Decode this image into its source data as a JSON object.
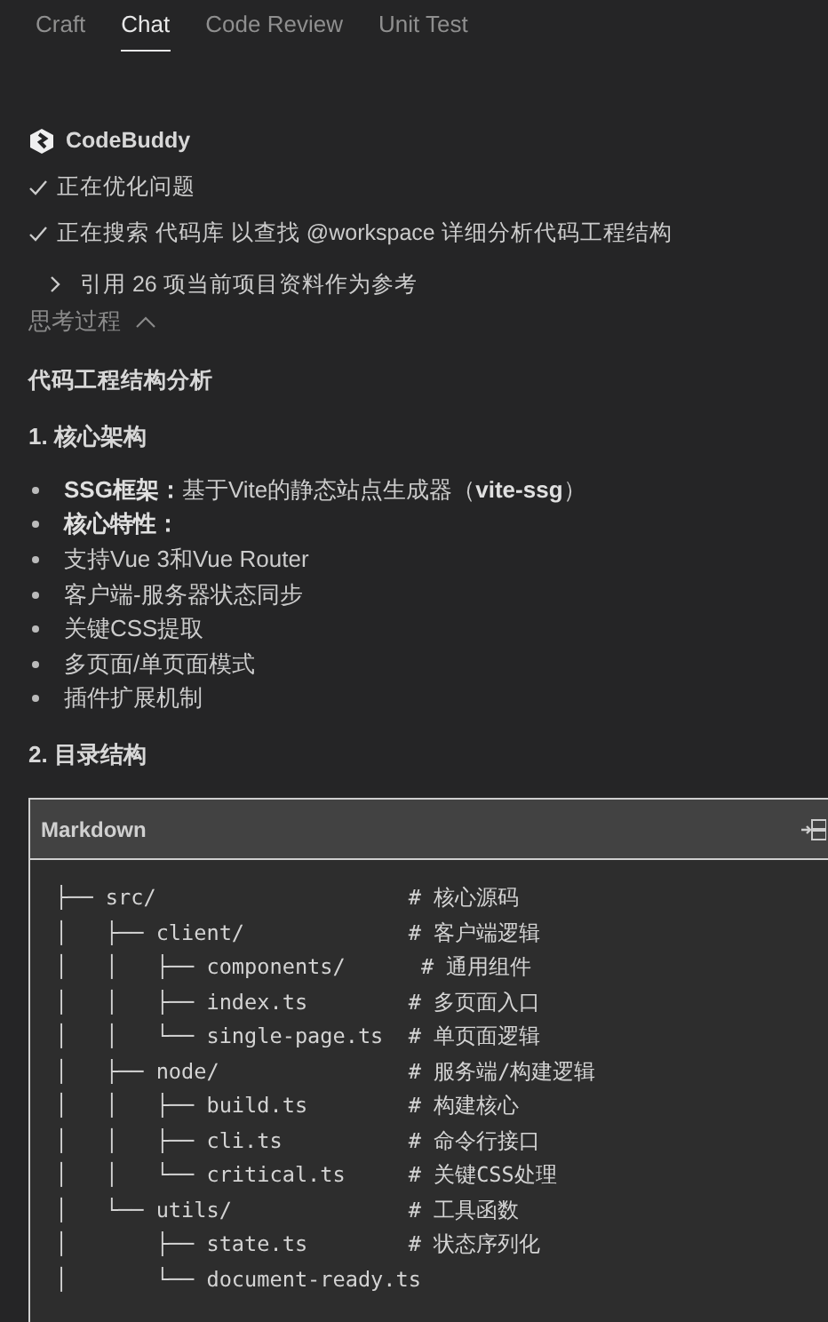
{
  "tabs": [
    {
      "label": "Craft",
      "selected": false
    },
    {
      "label": "Chat",
      "selected": true
    },
    {
      "label": "Code Review",
      "selected": false
    },
    {
      "label": "Unit Test",
      "selected": false
    }
  ],
  "assistant": {
    "name": "CodeBuddy"
  },
  "steps": [
    {
      "kind": "done",
      "text": "正在优化问题"
    },
    {
      "kind": "done",
      "text": "正在搜索 代码库 以查找 @workspace 详细分析代码工程结构"
    },
    {
      "kind": "reference",
      "text": "引用 26 项当前项目资料作为参考"
    }
  ],
  "thinking": {
    "label": "思考过程",
    "expanded": true
  },
  "answer": {
    "title": "代码工程结构分析",
    "sections": [
      {
        "heading": "1. 核心架构",
        "bullets": [
          {
            "text": "**SSG框架：**基于Vite的静态站点生成器（**vite-ssg**）",
            "strong": false
          },
          {
            "text": "核心特性：",
            "strong": true
          },
          {
            "text": "支持Vue 3和Vue Router",
            "strong": false
          },
          {
            "text": "客户端-服务器状态同步",
            "strong": false
          },
          {
            "text": "关键CSS提取",
            "strong": false
          },
          {
            "text": "多页面/单页面模式",
            "strong": false
          },
          {
            "text": "插件扩展机制",
            "strong": false
          }
        ]
      },
      {
        "heading": "2. 目录结构"
      }
    ],
    "code_block": {
      "language": "Markdown",
      "lines": [
        "├── src/                    # 核心源码",
        "│   ├── client/             # 客户端逻辑",
        "│   │   ├── components/      # 通用组件",
        "│   │   ├── index.ts        # 多页面入口",
        "│   │   └── single-page.ts  # 单页面逻辑",
        "│   ├── node/               # 服务端/构建逻辑",
        "│   │   ├── build.ts        # 构建核心",
        "│   │   ├── cli.ts          # 命令行接口",
        "│   │   └── critical.ts     # 关键CSS处理",
        "│   └── utils/              # 工具函数",
        "│       ├── state.ts        # 状态序列化",
        "│       └── document-ready.ts"
      ]
    }
  }
}
